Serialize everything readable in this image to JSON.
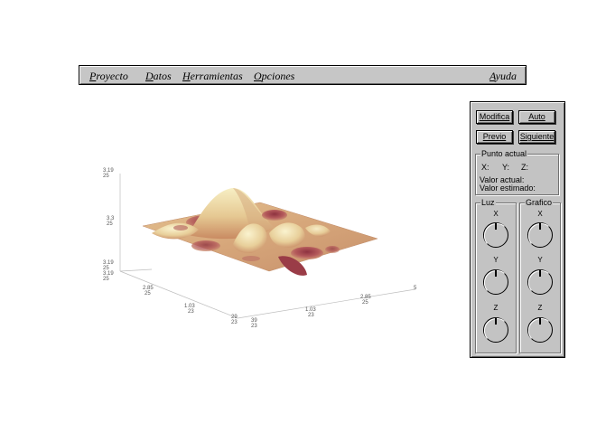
{
  "menubar": {
    "items": [
      {
        "mnemonic": "P",
        "rest": "royecto"
      },
      {
        "mnemonic": "D",
        "rest": "atos"
      },
      {
        "mnemonic": "H",
        "rest": "erramientas"
      },
      {
        "mnemonic": "O",
        "rest": "pciones"
      }
    ],
    "help": {
      "mnemonic": "A",
      "rest": "yuda"
    }
  },
  "plot": {
    "z_ticks": [
      "3.19\n25",
      "3.3\n25",
      "3.19\n25"
    ],
    "x_ticks": [
      "2.85\n25",
      "1.03\n23",
      "39\n23"
    ],
    "y_ticks": [
      "29\n23",
      "1.83\n23",
      "2.85\n25",
      "5"
    ],
    "colors": {
      "peak": "#f3e7b1",
      "mid": "#d8a673",
      "valley": "#a8494f",
      "axis": "#bfbfbf"
    }
  },
  "panel": {
    "buttons": {
      "modify": "Modifica",
      "auto": "Auto",
      "previous": "Previo",
      "next": "Siguiente"
    },
    "current_point": {
      "title": "Punto actual",
      "x_label": "X:",
      "y_label": "Y:",
      "z_label": "Z:",
      "actual_value": "Valor actual:",
      "estimated_value": "Valor estimado:"
    },
    "light": {
      "title": "Luz",
      "axes": [
        "X",
        "Y",
        "Z"
      ]
    },
    "graph": {
      "title": "Grafico",
      "axes": [
        "X",
        "Y",
        "Z"
      ]
    }
  }
}
